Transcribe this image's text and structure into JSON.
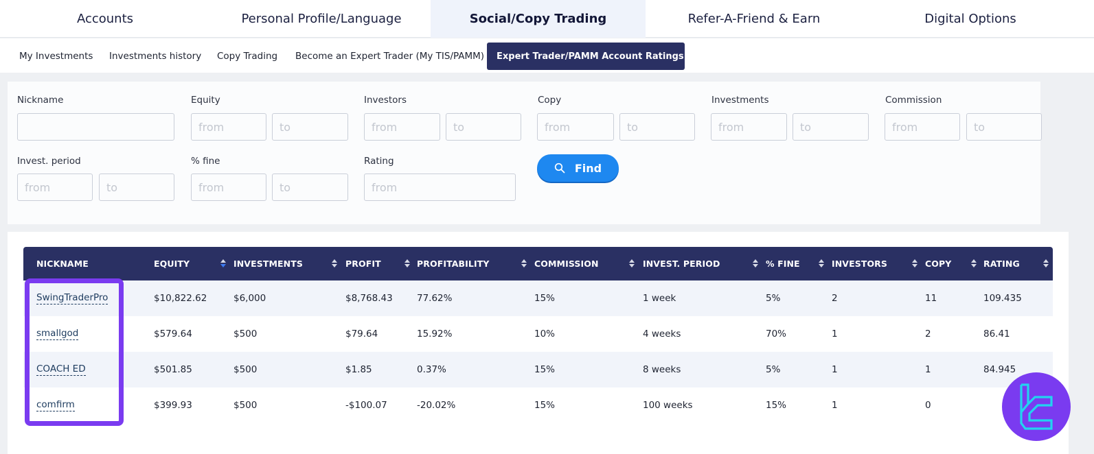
{
  "top_nav": {
    "tabs": [
      {
        "label": "Accounts",
        "active": false
      },
      {
        "label": "Personal Profile/Language",
        "active": false
      },
      {
        "label": "Social/Copy Trading",
        "active": true
      },
      {
        "label": "Refer-A-Friend & Earn",
        "active": false
      },
      {
        "label": "Digital Options",
        "active": false
      }
    ]
  },
  "sub_nav": {
    "items": [
      {
        "label": "My Investments",
        "active": false
      },
      {
        "label": "Investments history",
        "active": false
      },
      {
        "label": "Copy Trading",
        "active": false
      },
      {
        "label": "Become an Expert Trader (My TIS/PAMM)",
        "active": false
      },
      {
        "label": "Expert Trader/PAMM Account Ratings",
        "active": true
      }
    ]
  },
  "filters": {
    "nickname": {
      "label": "Nickname",
      "value": ""
    },
    "equity": {
      "label": "Equity",
      "from_placeholder": "from",
      "to_placeholder": "to"
    },
    "investors": {
      "label": "Investors",
      "from_placeholder": "from",
      "to_placeholder": "to"
    },
    "copy": {
      "label": "Copy",
      "from_placeholder": "from",
      "to_placeholder": "to"
    },
    "investments": {
      "label": "Investments",
      "from_placeholder": "from",
      "to_placeholder": "to"
    },
    "commission": {
      "label": "Commission",
      "from_placeholder": "from",
      "to_placeholder": "to"
    },
    "invest_period": {
      "label": "Invest. period",
      "from_placeholder": "from",
      "to_placeholder": "to"
    },
    "fine": {
      "label": "% fine",
      "from_placeholder": "from",
      "to_placeholder": "to"
    },
    "rating": {
      "label": "Rating",
      "from_placeholder": "from"
    },
    "find_button": {
      "label": "Find",
      "icon": "search-icon"
    }
  },
  "table": {
    "columns": [
      {
        "label": "NICKNAME",
        "sortable": false
      },
      {
        "label": "EQUITY",
        "sortable": true,
        "sort": "desc"
      },
      {
        "label": "INVESTMENTS",
        "sortable": true
      },
      {
        "label": "PROFIT",
        "sortable": true
      },
      {
        "label": "PROFITABILITY",
        "sortable": true
      },
      {
        "label": "COMMISSION",
        "sortable": true
      },
      {
        "label": "INVEST. PERIOD",
        "sortable": true
      },
      {
        "label": "% FINE",
        "sortable": true
      },
      {
        "label": "INVESTORS",
        "sortable": true
      },
      {
        "label": "COPY",
        "sortable": true
      },
      {
        "label": "RATING",
        "sortable": true
      }
    ],
    "rows": [
      [
        "SwingTraderPro",
        "$10,822.62",
        "$6,000",
        "$8,768.43",
        "77.62%",
        "15%",
        "1 week",
        "5%",
        "2",
        "11",
        "109.435"
      ],
      [
        "smallgod",
        "$579.64",
        "$500",
        "$79.64",
        "15.92%",
        "10%",
        "4 weeks",
        "70%",
        "1",
        "2",
        "86.41"
      ],
      [
        "COACH ED",
        "$501.85",
        "$500",
        "$1.85",
        "0.37%",
        "15%",
        "8 weeks",
        "5%",
        "1",
        "1",
        "84.945"
      ],
      [
        "comfirm",
        "$399.93",
        "$500",
        "-$100.07",
        "-20.02%",
        "15%",
        "100 weeks",
        "15%",
        "1",
        "0",
        ""
      ]
    ]
  },
  "colors": {
    "header_navy": "#2a3063",
    "find_blue": "#1e88f0",
    "highlight_purple": "#7a3bf0",
    "logo_cyan": "#22d3f0"
  },
  "watermark": {
    "icon": "brand-logo-icon"
  }
}
